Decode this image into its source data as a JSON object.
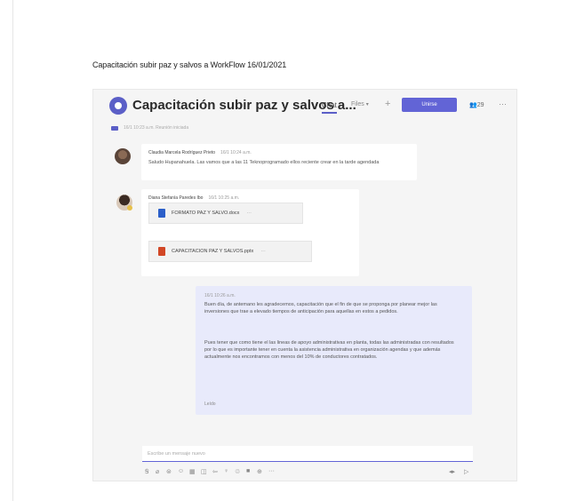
{
  "document": {
    "title": "Capacitación subir paz y salvos a WorkFlow 16/01/2021"
  },
  "header": {
    "meeting_title": "Capacitación subir paz y salvos a...",
    "tabs": [
      "Chat",
      "Files"
    ],
    "add_tab": "+",
    "join_label": "Unirse",
    "participants": "29",
    "more": "···"
  },
  "subheader": {
    "text": "16/1 10:23 a.m.  Reunión iniciada"
  },
  "messages": [
    {
      "sender": "Claudia Marcela Rodríguez Prieto",
      "time": "16/1 10:24 a.m.",
      "text": "Saludo Hupanahuela. Las vamos que a las 11 Teknoprogramado ellos reciente crear en la tarde agendada"
    },
    {
      "sender": "Diana Stefanía Paredes Ibo",
      "time": "16/1 10:25 a.m.",
      "files": [
        {
          "name": "FORMATO PAZ Y SALVO.docx",
          "type": "word"
        },
        {
          "name": "CAPACITACION PAZ Y SALVOS.pptx",
          "type": "powerpoint"
        }
      ]
    },
    {
      "time": "16/1 10:26 a.m.",
      "paragraph1": "Buen día, de antemano les agradecemos, capacitación que el fin de que se proponga por planear mejor las inversiones que trae a elevado tiempos de anticipación para aquellas en estos a pedidos.",
      "paragraph2": "Pues tener que como tiene el las lineas de apoyo administrativas en planta, todas las administradas con resultados por lo que es importante tener en cuenta la asistencia administrativa en organización agendas y que además actualmente nos encontramos con menos del 10% de conductores contratados.",
      "seen": "Leído"
    }
  ],
  "compose": {
    "placeholder": "Escribe un mensaje nuevo"
  },
  "toolbar": {
    "icons": [
      "format-icon",
      "attach-icon",
      "emoji-icon",
      "gif-icon",
      "sticker-icon",
      "meet-icon",
      "schedule-icon",
      "praise-icon",
      "loop-icon",
      "video-icon",
      "apps-icon",
      "more-icon"
    ],
    "glyphs": [
      "Ꞩ",
      "⌀",
      "⊜",
      "☺",
      "▦",
      "◫",
      "⇦",
      "♀",
      "♲",
      "■",
      "⊕",
      "···"
    ],
    "send_glyphs": [
      "◂▸",
      "▷"
    ]
  },
  "colors": {
    "accent": "#6264d6",
    "own_bubble": "#e8eafb",
    "word": "#2b5fc9",
    "powerpoint": "#d24726"
  }
}
